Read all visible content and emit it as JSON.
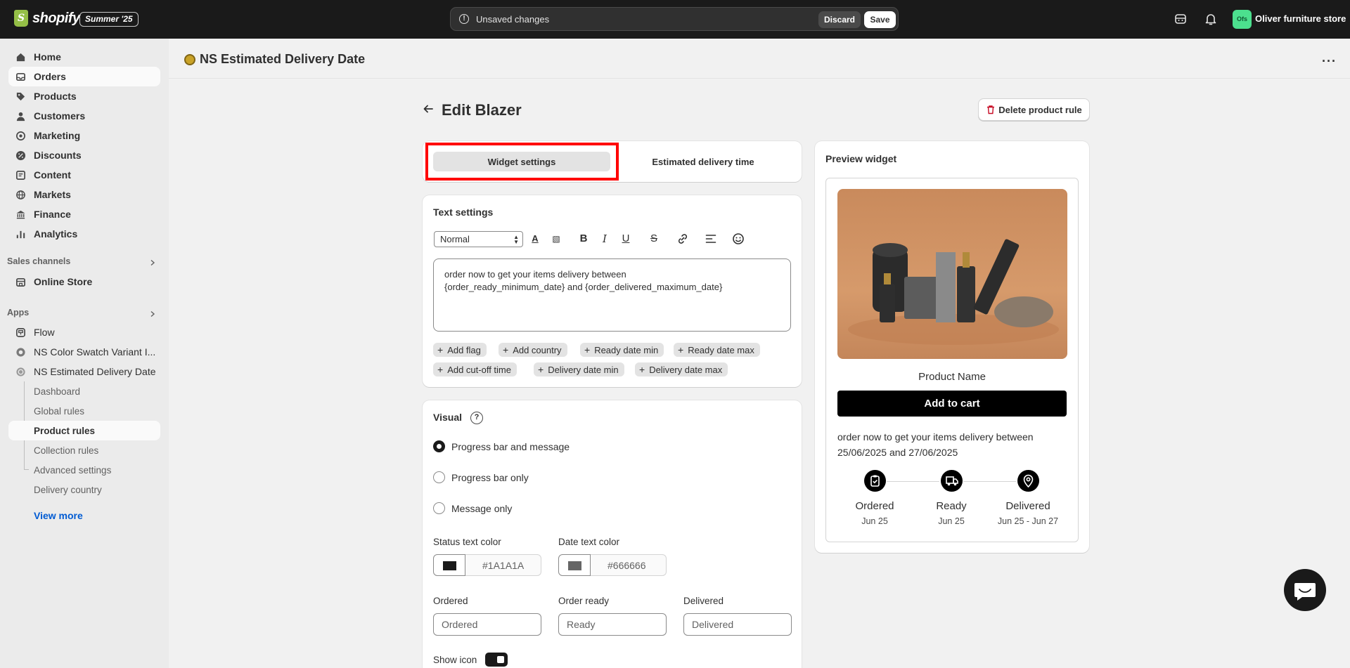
{
  "topbar": {
    "logo_text": "shopify",
    "badge": "Summer '25",
    "unsaved_text": "Unsaved changes",
    "discard_label": "Discard",
    "save_label": "Save",
    "store_initials": "Ofs",
    "store_name": "Oliver furniture store"
  },
  "sidebar": {
    "main_items": [
      {
        "label": "Home",
        "icon": "home-icon"
      },
      {
        "label": "Orders",
        "icon": "orders-icon"
      },
      {
        "label": "Products",
        "icon": "tag-icon"
      },
      {
        "label": "Customers",
        "icon": "person-icon"
      },
      {
        "label": "Marketing",
        "icon": "target-icon"
      },
      {
        "label": "Discounts",
        "icon": "discount-icon"
      },
      {
        "label": "Content",
        "icon": "content-icon"
      },
      {
        "label": "Markets",
        "icon": "globe-icon"
      },
      {
        "label": "Finance",
        "icon": "bank-icon"
      },
      {
        "label": "Analytics",
        "icon": "chart-icon"
      }
    ],
    "sales_channels_label": "Sales channels",
    "online_store": "Online Store",
    "apps_label": "Apps",
    "apps": [
      "Flow",
      "NS Color Swatch Variant I...",
      "NS Estimated Delivery Date"
    ],
    "sub_items": [
      "Dashboard",
      "Global rules",
      "Product rules",
      "Collection rules",
      "Advanced settings",
      "Delivery country"
    ],
    "view_more": "View more"
  },
  "app_header": {
    "title": "NS Estimated Delivery Date",
    "more": "···"
  },
  "page": {
    "title": "Edit Blazer",
    "delete_label": "Delete product rule"
  },
  "tabs": {
    "widget_settings": "Widget settings",
    "estimated_delivery_time": "Estimated delivery time"
  },
  "text_settings": {
    "title": "Text settings",
    "format_select": "Normal",
    "editor_line1": "order now to get your items delivery between",
    "editor_line2": "{order_ready_minimum_date} and {order_delivered_maximum_date}",
    "chips_row1": [
      "Add flag",
      "Add country",
      "Ready date min",
      "Ready date max"
    ],
    "chips_row2": [
      "Add cut-off time",
      "Delivery date min",
      "Delivery date max"
    ]
  },
  "visual": {
    "title": "Visual",
    "options": [
      "Progress bar and message",
      "Progress bar only",
      "Message only"
    ],
    "selected_option": "Progress bar and message",
    "status_text_color_label": "Status text color",
    "status_text_color": "#1A1A1A",
    "date_text_color_label": "Date text color",
    "date_text_color": "#666666",
    "ordered_label": "Ordered",
    "ordered_placeholder": "Ordered",
    "order_ready_label": "Order ready",
    "order_ready_placeholder": "Ready",
    "delivered_label": "Delivered",
    "delivered_placeholder": "Delivered",
    "show_icon_label": "Show icon",
    "show_icon": true
  },
  "preview": {
    "title": "Preview widget",
    "product_name": "Product Name",
    "add_to_cart": "Add to cart",
    "message_line1": "order now to get your items delivery between",
    "message_line2": "25/06/2025 and 27/06/2025",
    "steps": [
      {
        "label": "Ordered",
        "date": "Jun 25",
        "icon": "clipboard-check-icon"
      },
      {
        "label": "Ready",
        "date": "Jun 25",
        "icon": "truck-icon"
      },
      {
        "label": "Delivered",
        "date": "Jun 25 - Jun 27",
        "icon": "map-pin-icon"
      }
    ]
  },
  "colors": {
    "topbar_bg": "#1a1a1a",
    "highlight": "#ff0000",
    "link": "#005bd3",
    "store_avatar": "#4ce08e"
  }
}
